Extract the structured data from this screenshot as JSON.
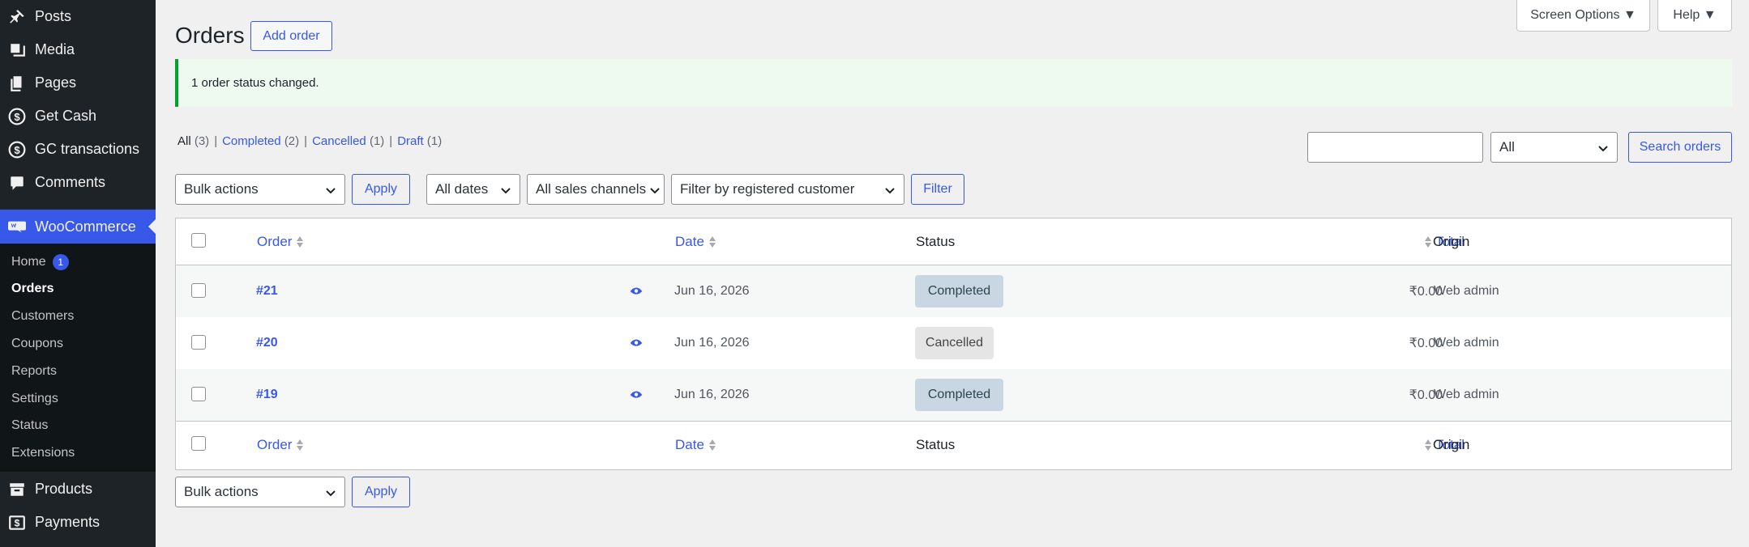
{
  "sidebar": {
    "items": [
      {
        "label": "Posts",
        "icon": "pin-icon"
      },
      {
        "label": "Media",
        "icon": "media-icon"
      },
      {
        "label": "Pages",
        "icon": "pages-icon"
      },
      {
        "label": "Get Cash",
        "icon": "dollar-icon"
      },
      {
        "label": "GC transactions",
        "icon": "dollar-icon"
      },
      {
        "label": "Comments",
        "icon": "comment-icon"
      }
    ],
    "woocommerce": {
      "label": "WooCommerce",
      "icon": "woo-icon"
    },
    "submenu": [
      {
        "label": "Home",
        "badge": "1"
      },
      {
        "label": "Orders"
      },
      {
        "label": "Customers"
      },
      {
        "label": "Coupons"
      },
      {
        "label": "Reports"
      },
      {
        "label": "Settings"
      },
      {
        "label": "Status"
      },
      {
        "label": "Extensions"
      }
    ],
    "bottom_items": [
      {
        "label": "Products",
        "icon": "archive-icon"
      },
      {
        "label": "Payments",
        "icon": "payments-icon"
      }
    ]
  },
  "header": {
    "title": "Orders",
    "add_order_label": "Add order",
    "screen_options_label": "Screen Options ▼",
    "help_label": "Help ▼"
  },
  "notice": {
    "text": "1 order status changed."
  },
  "filters_views": {
    "all": "All",
    "all_count": "(3)",
    "completed": "Completed",
    "completed_count": "(2)",
    "cancelled": "Cancelled",
    "cancelled_count": "(1)",
    "draft": "Draft",
    "draft_count": "(1)"
  },
  "search": {
    "placeholder": "",
    "scope_value": "All",
    "button_label": "Search orders"
  },
  "toolbar": {
    "bulk_actions": "Bulk actions",
    "apply_label": "Apply",
    "dates": "All dates",
    "sales_channels": "All sales channels",
    "customer_filter": "Filter by registered customer",
    "filter_label": "Filter"
  },
  "table": {
    "columns": {
      "order": "Order",
      "date": "Date",
      "status": "Status",
      "total": "Total",
      "origin": "Origin"
    },
    "rows": [
      {
        "order": "#21",
        "date": "Jun 16, 2026",
        "status": "Completed",
        "total": "₹0.00",
        "origin": "Web admin"
      },
      {
        "order": "#20",
        "date": "Jun 16, 2026",
        "status": "Cancelled",
        "total": "₹0.00",
        "origin": "Web admin"
      },
      {
        "order": "#19",
        "date": "Jun 16, 2026",
        "status": "Completed",
        "total": "₹0.00",
        "origin": "Web admin"
      }
    ]
  },
  "bottom_toolbar": {
    "bulk_actions": "Bulk actions",
    "apply_label": "Apply"
  }
}
